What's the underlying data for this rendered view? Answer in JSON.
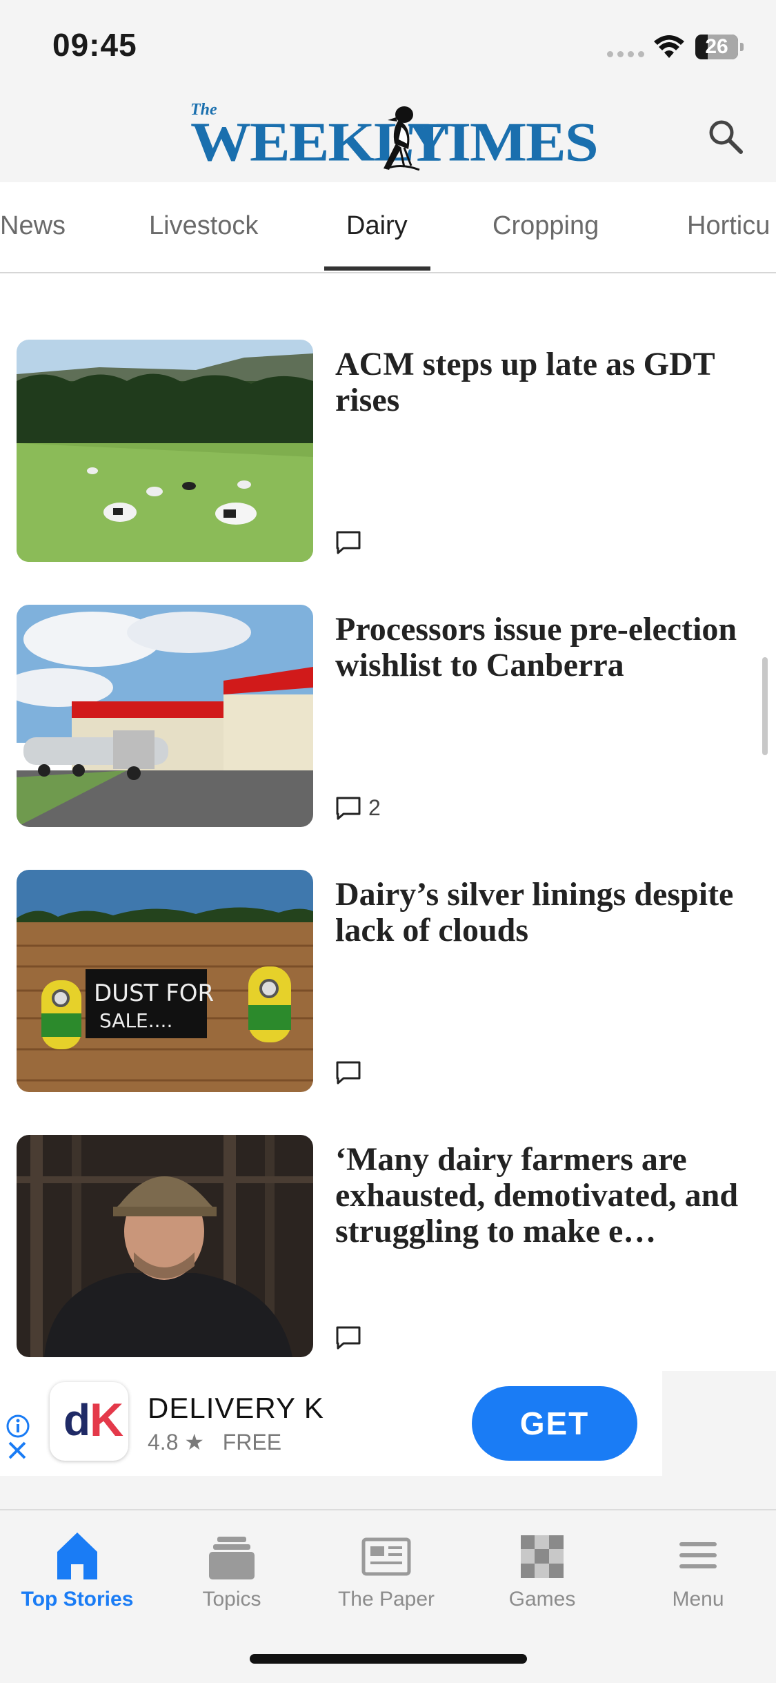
{
  "status_bar": {
    "time": "09:45",
    "battery": "26",
    "wifi_icon": "wifi-icon",
    "signal_icon": "signal-dots-icon"
  },
  "header": {
    "logo_small": "The",
    "logo_word_1": "WEEKLY",
    "logo_word_2": "TIMES",
    "logo_icon": "magpie-logo",
    "search_icon": "search-icon"
  },
  "tabs": [
    {
      "label": "News"
    },
    {
      "label": "Livestock"
    },
    {
      "label": "Dairy"
    },
    {
      "label": "Cropping"
    },
    {
      "label": "Horticu"
    }
  ],
  "active_tab": "Dairy",
  "articles": [
    {
      "headline": "ACM steps up late as GDT rises",
      "comment_count": "",
      "image": "cows-grazing-photo"
    },
    {
      "headline": "Processors issue pre-election wishlist to Canberra",
      "comment_count": "2",
      "image": "milk-tanker-factory-photo"
    },
    {
      "headline": "Dairy’s silver linings despite lack of clouds",
      "comment_count": "",
      "image": "dust-for-sale-field-photo"
    },
    {
      "headline": "‘Many dairy farmers are exhausted, demotivated, and struggling to make e…",
      "comment_count": "",
      "image": "farmer-portrait-photo"
    }
  ],
  "ad": {
    "icon_letters": [
      "d",
      "K"
    ],
    "title": "DELIVERY K",
    "rating": "4.8 ★",
    "price": "FREE",
    "cta": "GET",
    "info_icon": "info-icon",
    "close_icon": "close-icon"
  },
  "bottom_nav": [
    {
      "label": "Top Stories",
      "icon": "home-icon"
    },
    {
      "label": "Topics",
      "icon": "stack-icon"
    },
    {
      "label": "The Paper",
      "icon": "newspaper-icon"
    },
    {
      "label": "Games",
      "icon": "checker-icon"
    },
    {
      "label": "Menu",
      "icon": "hamburger-icon"
    }
  ],
  "colors": {
    "brand_blue": "#1a6fae",
    "accent_blue": "#1a7cf5",
    "ad_red": "#e4394a"
  }
}
